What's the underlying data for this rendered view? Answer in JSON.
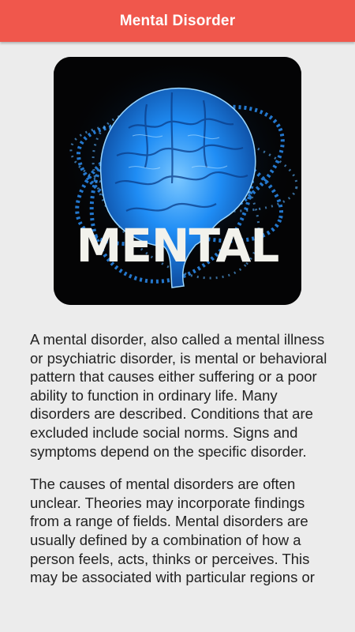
{
  "appbar": {
    "title": "Mental Disorder",
    "background": "#f0574c"
  },
  "hero": {
    "icon": "brain-image",
    "caption": "MENTAL",
    "glow_color": "#1e8fff"
  },
  "content": {
    "paragraphs": [
      "A mental disorder, also called a mental illness or psychiatric disorder, is mental or behavioral pattern that causes either suffering or a poor ability to function in ordinary life. Many disorders are described. Conditions that are excluded include social norms. Signs and symptoms depend on the specific disorder.",
      "The causes of mental disorders are often unclear. Theories may incorporate findings from a range of fields. Mental disorders are usually defined by a combination of how a person feels, acts, thinks or perceives. This may be associated with particular regions or"
    ]
  }
}
